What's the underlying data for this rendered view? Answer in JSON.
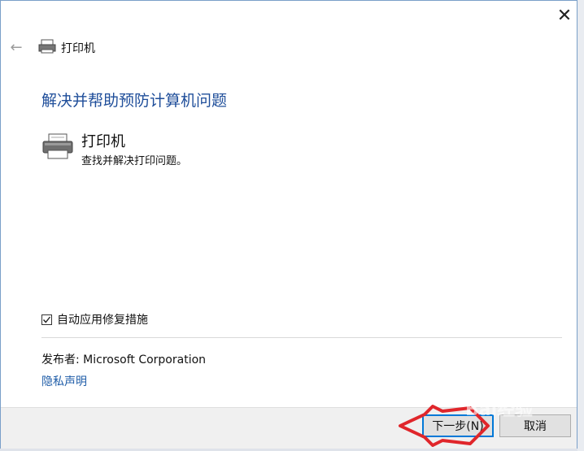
{
  "window": {
    "nav_title": "打印机",
    "heading": "解决并帮助预防计算机问题"
  },
  "item": {
    "title": "打印机",
    "description": "查找并解决打印问题。"
  },
  "options": {
    "auto_fix_label": "自动应用修复措施",
    "auto_fix_checked": true
  },
  "info": {
    "publisher": "发布者:  Microsoft Corporation",
    "privacy_link": "隐私声明"
  },
  "buttons": {
    "next": "下一步(N)",
    "cancel": "取消"
  },
  "icons": {
    "close": "close-icon",
    "back": "back-arrow-icon",
    "printer": "printer-icon"
  },
  "colors": {
    "heading": "#1f4e9a",
    "link": "#1f5da8",
    "marker": "#e0262b"
  }
}
